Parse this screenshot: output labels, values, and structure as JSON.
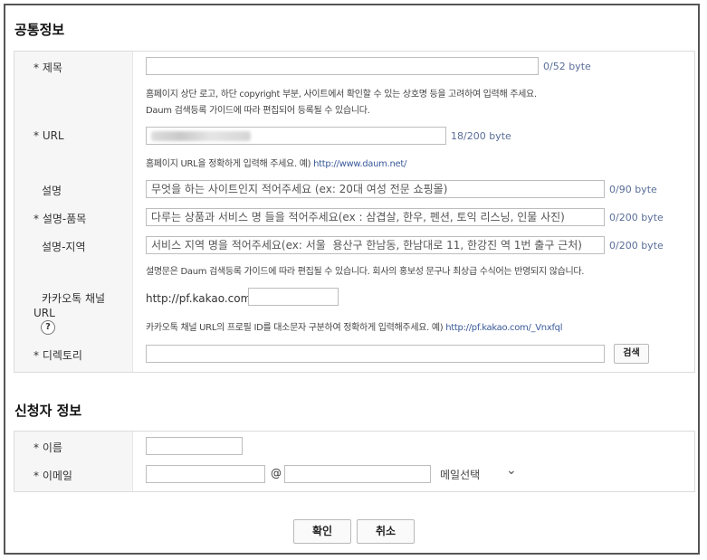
{
  "sections": {
    "common": {
      "title": "공통정보",
      "title_field": {
        "label": "* 제목",
        "value": "",
        "count": "0/52 byte",
        "help1": "홈페이지 상단 로고, 하단 copyright 부분, 사이트에서 확인할 수 있는 상호명 등을 고려하여 입력해 주세요.",
        "help2": "Daum 검색등록 가이드에 따라 편집되어 등록될 수 있습니다."
      },
      "url_field": {
        "label": "* URL",
        "count": "18/200 byte",
        "help_prefix": "홈페이지 URL을 정확하게 입력해 주세요. 예) ",
        "help_example": "http://www.daum.net/"
      },
      "desc_field": {
        "label": "설명",
        "placeholder": "무엇을 하는 사이트인지 적어주세요 (ex: 20대 여성 전문 쇼핑몰)",
        "count": "0/90 byte"
      },
      "desc_items_field": {
        "label": "* 설명-품목",
        "placeholder": "다루는 상품과 서비스 명 들을 적어주세요(ex : 삼겹살, 한우, 펜션, 토익 리스닝, 인물 사진)",
        "count": "0/200 byte"
      },
      "desc_region_field": {
        "label": "설명-지역",
        "placeholder": "서비스 지역 명을 적어주세요(ex: 서울  용산구 한남동, 한남대로 11, 한강진 역 1번 출구 근처)",
        "count": "0/200 byte",
        "help": "설명문은 Daum 검색등록 가이드에 따라 편집될 수 있습니다. 회사의 홍보성 문구나 최상급 수식어는 반영되지 않습니다."
      },
      "kakao_field": {
        "label_line1": "카카오톡 채널",
        "label_line2": "URL",
        "help_icon": "?",
        "prefix": "http://pf.kakao.com/",
        "value": "",
        "help_prefix": "카카오톡 채널 URL의 프로필 ID를 대소문자 구분하여 정확하게 입력해주세요. 예) ",
        "help_example": "http://pf.kakao.com/_Vnxfql"
      },
      "directory_field": {
        "label": "* 디렉토리",
        "value": "",
        "search_label": "검색"
      }
    },
    "applicant": {
      "title": "신청자 정보",
      "name_field": {
        "label": "* 이름",
        "value": ""
      },
      "email_field": {
        "label": "* 이메일",
        "at": "@",
        "select_label": "메일선택",
        "chevron": "⌄"
      }
    }
  },
  "actions": {
    "confirm_label": "확인",
    "cancel_label": "취소"
  }
}
